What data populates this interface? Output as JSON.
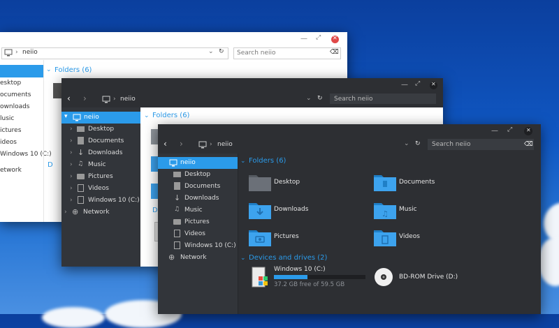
{
  "window_title": "neiio",
  "search_placeholder": "Search neiio",
  "folders_header": "Folders (6)",
  "devices_header": "Devices and drives (2)",
  "nav": {
    "root": "neiio",
    "items": [
      "Desktop",
      "Documents",
      "Downloads",
      "Music",
      "Pictures",
      "Videos",
      "Windows 10 (C:)"
    ],
    "network": "Network"
  },
  "back_window_nav": [
    "esktop",
    "ocuments",
    "ownloads",
    "lusic",
    "ictures",
    "ideos",
    "Windows 10 (C:)",
    "etwork"
  ],
  "folders": [
    "Desktop",
    "Documents",
    "Downloads",
    "Music",
    "Pictures",
    "Videos"
  ],
  "drives": {
    "c_name": "Windows 10 (C:)",
    "c_free": "37.2 GB free of 59.5 GB",
    "c_used_fraction": 0.37,
    "bd_name": "BD-ROM Drive (D:)"
  },
  "colors": {
    "accent": "#2b9bea",
    "dark_bg": "#2d2f33",
    "dark_nav": "#32353a",
    "folder_blue": "#3da3ee"
  }
}
